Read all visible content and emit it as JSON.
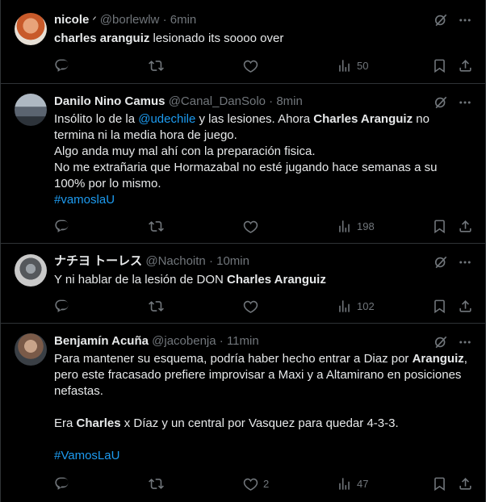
{
  "tweets": [
    {
      "name": "nicole",
      "name_suffix": "ᐟ",
      "handle": "@borlewlw",
      "sep": "·",
      "time": "6min",
      "text": {
        "bold1": "charles aranguiz",
        "rest1": " lesionado its soooo over"
      },
      "stats": {
        "replies": "",
        "retweets": "",
        "likes": "",
        "views": "50"
      }
    },
    {
      "name": "Danilo Nino Camus",
      "handle": "@Canal_DanSolo",
      "sep": "·",
      "time": "8min",
      "text": {
        "l1a": "Insólito lo de la ",
        "l1link": "@udechile",
        "l1b": " y las lesiones. Ahora ",
        "l1bold": "Charles Aranguiz",
        "l1c": " no termina ni la media hora de juego.",
        "l2": "Algo anda muy mal ahí con la preparación fisica.",
        "l3": "No me extrañaria que Hormazabal no esté jugando hace semanas a su 100% por lo mismo.",
        "hashtag": "#vamoslaU"
      },
      "stats": {
        "replies": "",
        "retweets": "",
        "likes": "",
        "views": "198"
      }
    },
    {
      "name": "ナチヨ トーレス",
      "handle": "@Nachoitn",
      "sep": "·",
      "time": "10min",
      "text": {
        "a": "Y ni hablar de la lesión de DON ",
        "bold": "Charles Aranguiz"
      },
      "stats": {
        "replies": "",
        "retweets": "",
        "likes": "",
        "views": "102"
      }
    },
    {
      "name": "Benjamín Acuña",
      "handle": "@jacobenja",
      "sep": "·",
      "time": "11min",
      "text": {
        "p1a": "Para mantener su esquema, podría haber hecho entrar a Diaz por ",
        "p1bold": "Aranguiz",
        "p1b": ", pero este fracasado prefiere improvisar a Maxi y a Altamirano en posiciones nefastas.",
        "p2bold1": "Charles",
        "p2a": "Era ",
        "p2b": " x Díaz y un central por Vasquez para quedar 4-3-3.",
        "hashtag": "#VamosLaU"
      },
      "stats": {
        "replies": "",
        "retweets": "",
        "likes": "2",
        "views": "47"
      }
    }
  ],
  "icons": [
    "grok-icon",
    "more-icon",
    "reply-icon",
    "retweet-icon",
    "like-icon",
    "views-icon",
    "bookmark-icon",
    "share-icon"
  ],
  "colors": {
    "background": "#000000",
    "text": "#e7e9ea",
    "muted": "#71767b",
    "link": "#1d9bf0",
    "border": "#2f3336"
  }
}
